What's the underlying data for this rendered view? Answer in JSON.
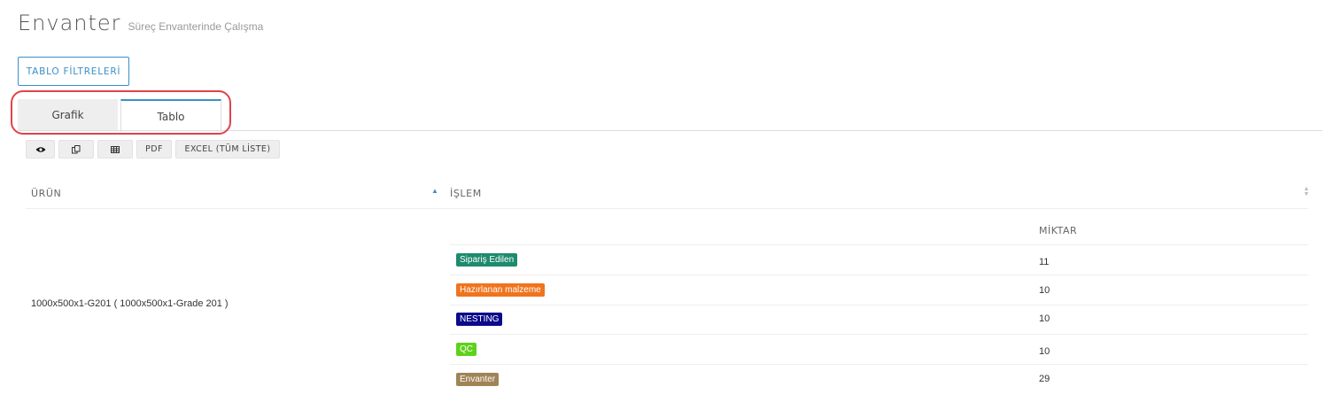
{
  "header": {
    "title": "Envanter",
    "subtitle": "Süreç Envanterinde Çalışma"
  },
  "filters_button": "TABLO FİLTRELERİ",
  "tabs": [
    {
      "label": "Grafik",
      "active": false
    },
    {
      "label": "Tablo",
      "active": true
    }
  ],
  "toolbar": {
    "view_icon": "eye-icon",
    "copy_icon": "copy-icon",
    "columns_icon": "table-icon",
    "pdf_label": "PDF",
    "excel_label": "EXCEL (TÜM LİSTE)"
  },
  "table": {
    "columns": [
      "ÜRÜN",
      "İŞLEM"
    ],
    "sub_column": "MİKTAR",
    "product": "1000x500x1-G201 ( 1000x500x1-Grade 201 )",
    "rows": [
      {
        "status": "Sipariş Edilen",
        "color": "#1e8a6e",
        "qty": "11"
      },
      {
        "status": "Hazırlanan malzeme",
        "color": "#f0741e",
        "qty": "10"
      },
      {
        "status": "NESTING",
        "color": "#0a0a8a",
        "qty": "10"
      },
      {
        "status": "QC",
        "color": "#5fd11b",
        "qty": "10"
      },
      {
        "status": "Envanter",
        "color": "#a08457",
        "qty": "29"
      }
    ]
  },
  "colors": {
    "accent": "#3a8fc8",
    "highlight": "#e2424b"
  }
}
